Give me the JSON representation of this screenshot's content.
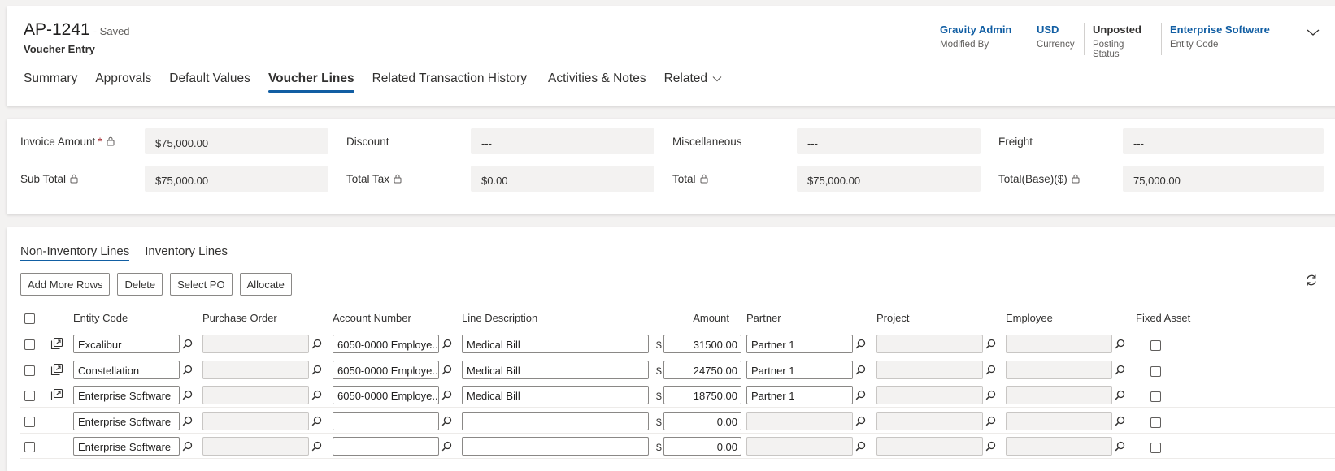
{
  "record": {
    "title": "AP-1241",
    "saved": "- Saved",
    "form": "Voucher Entry"
  },
  "header_fields": [
    {
      "value": "Gravity Admin",
      "label": "Modified By",
      "link": true
    },
    {
      "value": "USD",
      "label": "Currency",
      "link": true
    },
    {
      "value": "Unposted",
      "label": "Posting Status",
      "link": false
    },
    {
      "value": "Enterprise Software",
      "label": "Entity Code",
      "link": true
    }
  ],
  "tabs": [
    "Summary",
    "Approvals",
    "Default Values",
    "Voucher Lines",
    "Related Transaction History",
    "Activities & Notes",
    "Related"
  ],
  "active_tab": "Voucher Lines",
  "summary": {
    "invoice_amount": {
      "label": "Invoice Amount",
      "value": "$75,000.00"
    },
    "discount": {
      "label": "Discount",
      "value": "---"
    },
    "miscellaneous": {
      "label": "Miscellaneous",
      "value": "---"
    },
    "freight": {
      "label": "Freight",
      "value": "---"
    },
    "sub_total": {
      "label": "Sub Total",
      "value": "$75,000.00"
    },
    "total_tax": {
      "label": "Total Tax",
      "value": "$0.00"
    },
    "total": {
      "label": "Total",
      "value": "$75,000.00"
    },
    "total_base": {
      "label": "Total(Base)($)",
      "value": "75,000.00"
    }
  },
  "required_mark": "*",
  "line_tabs": [
    "Non-Inventory Lines",
    "Inventory Lines"
  ],
  "buttons": {
    "add_more_rows": "Add More Rows",
    "delete": "Delete",
    "select_po": "Select PO",
    "allocate": "Allocate"
  },
  "columns": {
    "entity_code": "Entity Code",
    "purchase_order": "Purchase Order",
    "account_number": "Account Number",
    "line_description": "Line Description",
    "amount": "Amount",
    "partner": "Partner",
    "project": "Project",
    "employee": "Employee",
    "fixed_asset": "Fixed Asset"
  },
  "currency_symbol": "$",
  "rows": [
    {
      "entity": "Excalibur",
      "po": "",
      "account": "6050-0000 Employe...",
      "desc": "Medical Bill",
      "amount": "31500.00",
      "partner": "Partner 1",
      "project": "",
      "employee": "",
      "has_record": true
    },
    {
      "entity": "Constellation",
      "po": "",
      "account": "6050-0000 Employe...",
      "desc": "Medical Bill",
      "amount": "24750.00",
      "partner": "Partner 1",
      "project": "",
      "employee": "",
      "has_record": true
    },
    {
      "entity": "Enterprise Software",
      "po": "",
      "account": "6050-0000 Employe...",
      "desc": "Medical Bill",
      "amount": "18750.00",
      "partner": "Partner 1",
      "project": "",
      "employee": "",
      "has_record": true
    },
    {
      "entity": "Enterprise Software",
      "po": "",
      "account": "",
      "desc": "",
      "amount": "0.00",
      "partner": "",
      "project": "",
      "employee": "",
      "has_record": false
    },
    {
      "entity": "Enterprise Software",
      "po": "",
      "account": "",
      "desc": "",
      "amount": "0.00",
      "partner": "",
      "project": "",
      "employee": "",
      "has_record": false
    }
  ]
}
